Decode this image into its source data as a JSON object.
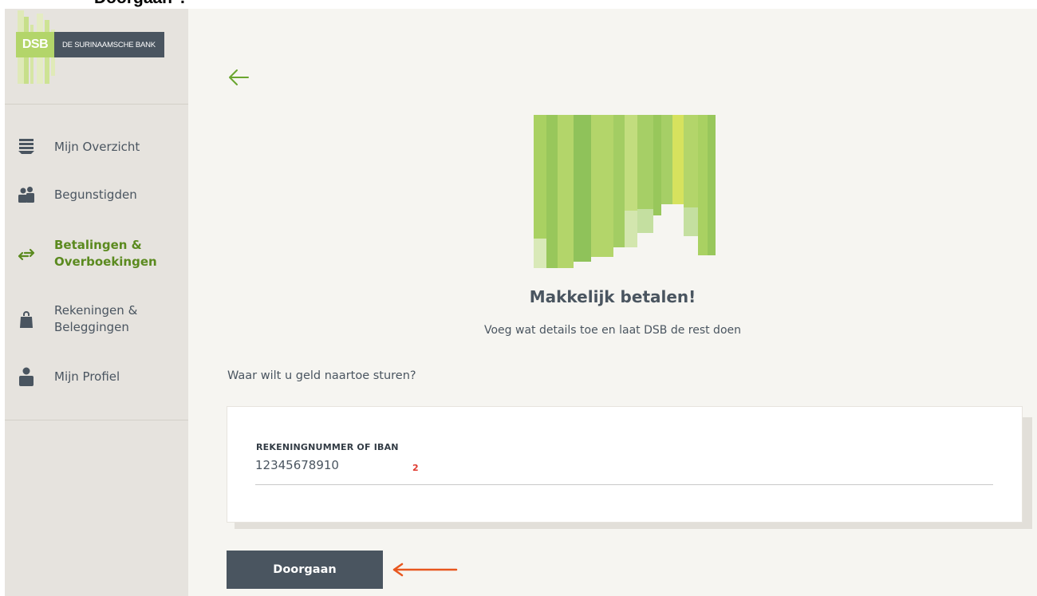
{
  "caption": "Doorgaan\".",
  "logo": {
    "short": "DSB",
    "name": "DE SURINAAMSCHE BANK"
  },
  "nav": [
    {
      "label": "Mijn Overzicht",
      "icon": "overview-icon"
    },
    {
      "label": "Begunstigden",
      "icon": "beneficiaries-icon"
    },
    {
      "label": "Betalingen &",
      "label2": "Overboekingen",
      "icon": "transfer-arrows-icon",
      "active": true
    },
    {
      "label": "Rekeningen &",
      "label2": "Beleggingen",
      "icon": "bag-icon"
    },
    {
      "label": "Mijn Profiel",
      "icon": "profile-icon"
    }
  ],
  "main": {
    "title": "Makkelijk betalen!",
    "subtitle": "Voeg wat details toe en laat DSB de rest doen",
    "question": "Waar wilt u geld naartoe sturen?",
    "field": {
      "label": "REKENINGNUMMER OF IBAN",
      "value": "12345678910"
    },
    "annotation_number": "2",
    "button": "Doorgaan"
  },
  "colors": {
    "brand_dark": "#4a5560",
    "brand_green": "#b3d56a",
    "active_green": "#5b8a1f",
    "annotation_arrow": "#e8571f",
    "annotation_number": "#e03a2f"
  }
}
